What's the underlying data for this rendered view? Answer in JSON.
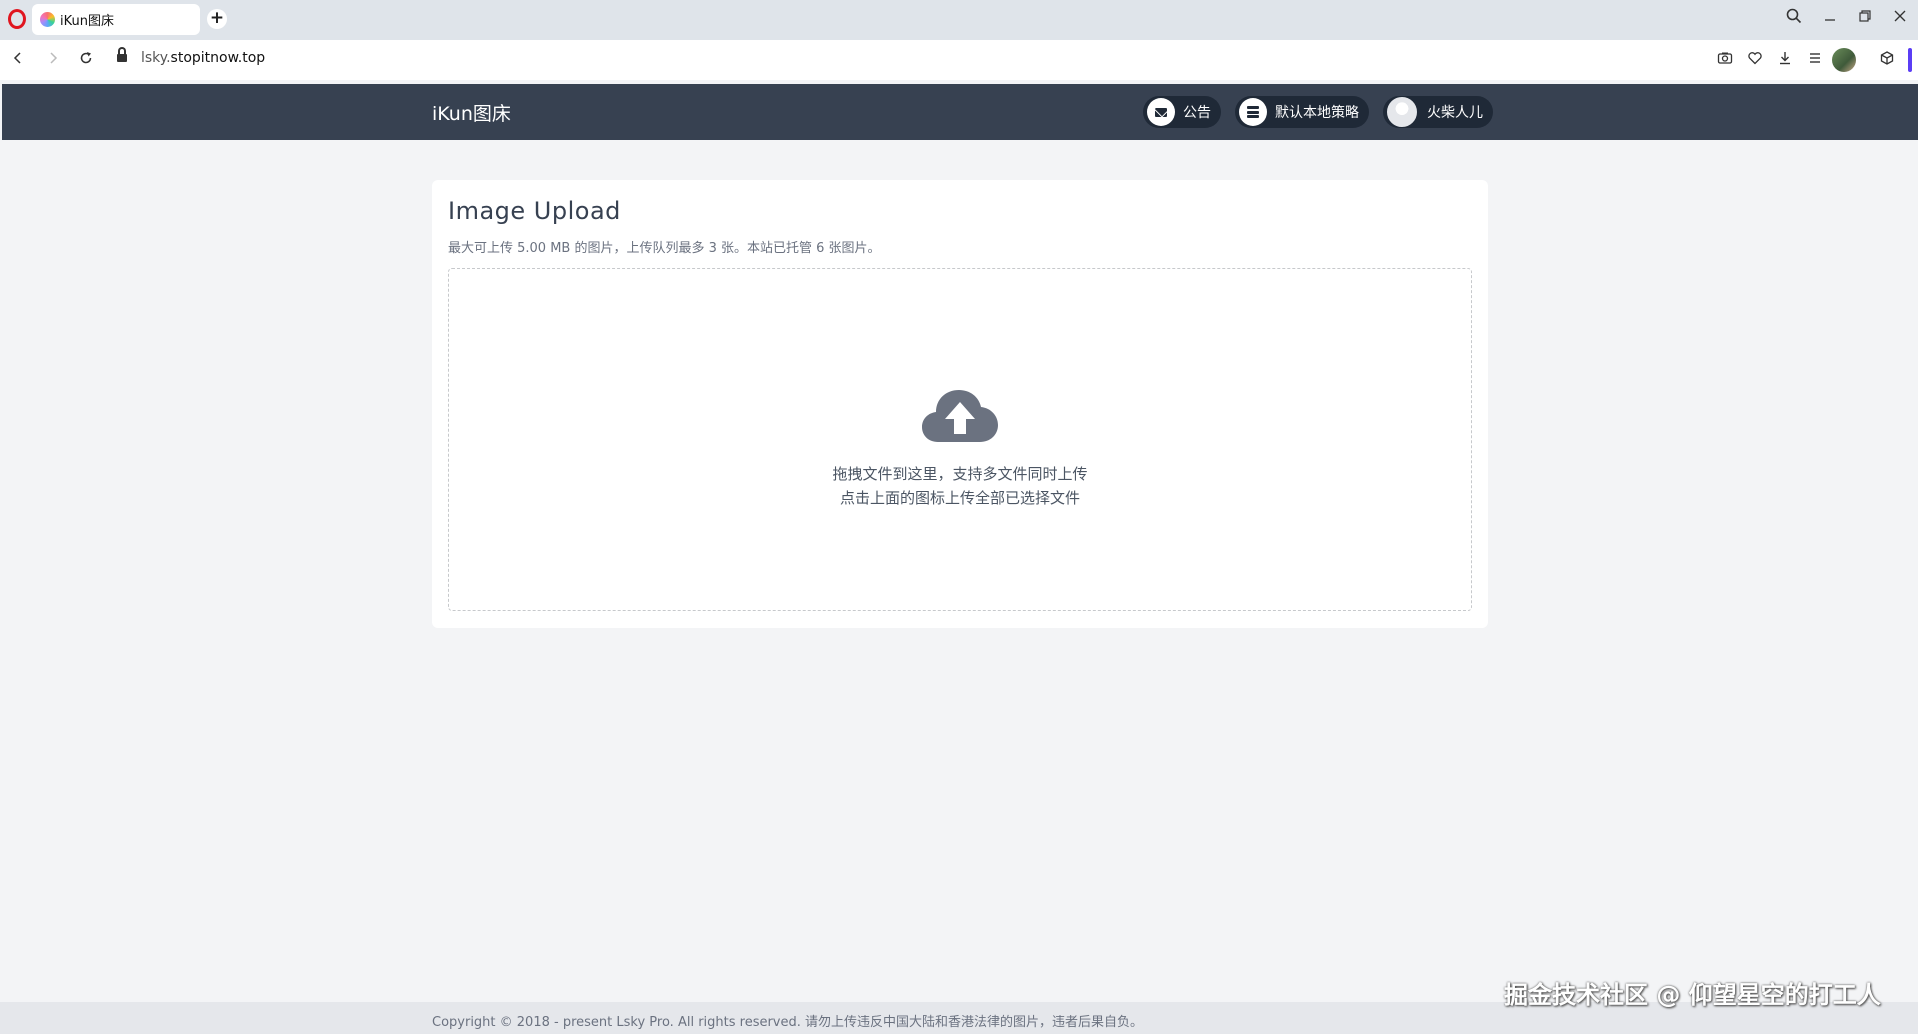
{
  "browser": {
    "tab_title": "iKun图床",
    "url_host": "lsky.",
    "url_domain": "stopitnow.top",
    "new_tab_glyph": "+"
  },
  "navbar": {
    "brand": "iKun图床",
    "notice_label": "公告",
    "strategy_label": "默认本地策略",
    "user_label": "火柴人儿"
  },
  "upload": {
    "title": "Image Upload",
    "subtitle": "最大可上传 5.00 MB 的图片，上传队列最多 3 张。本站已托管 6 张图片。",
    "drop_line1": "拖拽文件到这里，支持多文件同时上传",
    "drop_line2": "点击上面的图标上传全部已选择文件"
  },
  "footer": {
    "copyright": "Copyright © 2018 - present Lsky Pro. All rights reserved.   请勿上传违反中国大陆和香港法律的图片，违者后果自负。"
  },
  "watermark": "掘金技术社区 @ 仰望星空的打工人",
  "colors": {
    "navbar": "#374151",
    "pill": "#1f2937",
    "page_bg": "#f3f4f6",
    "opera_red": "#e0151f",
    "accent": "#5b3df5"
  }
}
